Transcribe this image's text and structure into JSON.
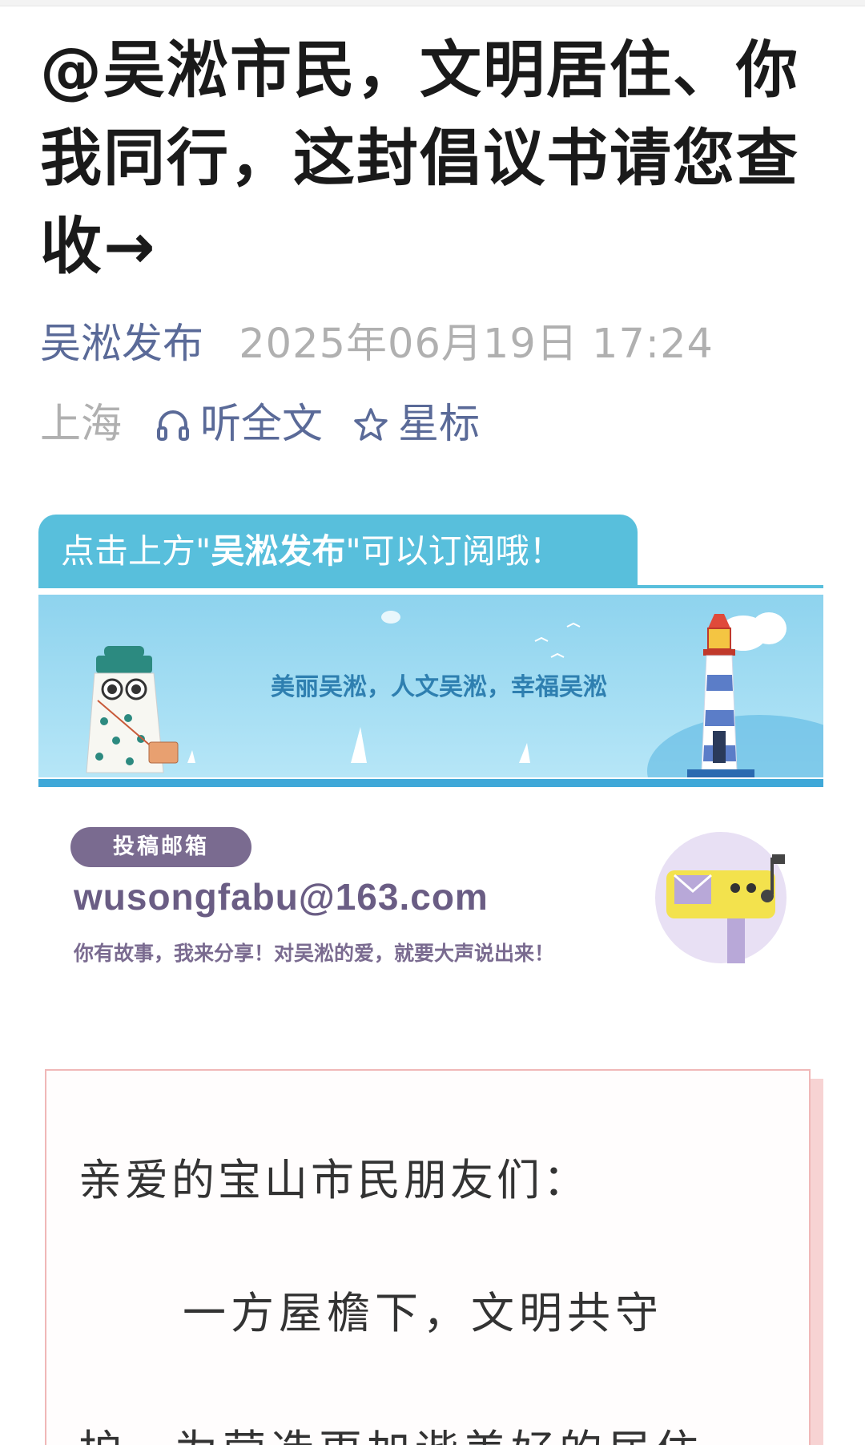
{
  "article": {
    "title": "@吴淞市民，文明居住、你我同行，这封倡议书请您查收→",
    "account": "吴淞发布",
    "datetime": "2025年06月19日 17:24",
    "location": "上海",
    "listen_label": "听全文",
    "star_label": "星标"
  },
  "banner": {
    "subscribe_prefix": "点击上方\"",
    "subscribe_account": "吴淞发布",
    "subscribe_suffix": "\"可以订阅哦！",
    "slogan": "美丽吴淞，人文吴淞，幸福吴淞"
  },
  "mailbox": {
    "badge": "投稿邮箱",
    "address": "wusongfabu@163.com",
    "tagline": "你有故事，我来分享！对吴淞的爱，就要大声说出来！"
  },
  "letter": {
    "greeting": "亲爱的宝山市民朋友们：",
    "para1": "一方屋檐下，文明共守",
    "para2_partial": "护，为营造更加谐美好的居住"
  },
  "colors": {
    "accent": "#5a6a98",
    "banner_blue": "#58bfdc",
    "mail_purple": "#7a6b90",
    "letter_border": "#f0b8b8"
  },
  "icons": [
    "headphones-icon",
    "star-outline-icon",
    "lighthouse-icon",
    "mascot-icon",
    "mailbox-icon"
  ]
}
